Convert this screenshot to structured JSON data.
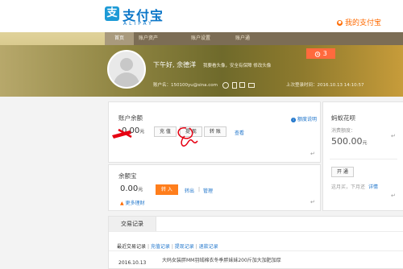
{
  "brand": {
    "cn": "支付宝",
    "en": "ALIPAY",
    "logo_char": "支"
  },
  "my_alipay": {
    "label": "我的支付宝",
    "icon": "alipay-dot-icon"
  },
  "nav": {
    "items": [
      "首页",
      "账户资产",
      "账户设置",
      "账户通"
    ]
  },
  "profile": {
    "greeting": "下午好, 余德洋",
    "tagline": "我要看头像，安全有保障 修改头像",
    "account_label": "账户名：",
    "account_value": "150100yu@sina.com",
    "login_label": "上次登录时间：",
    "login_time": "2016.10.13 14:10:57"
  },
  "notice": {
    "count": "3",
    "icon": "alarm-clock-icon"
  },
  "balance": {
    "title": "账户余额",
    "amount": "0.00",
    "unit": "元",
    "btn_recharge": "充 值",
    "btn_withdraw": "提 现",
    "btn_transfer": "转 账",
    "view": "查看",
    "settings": "额度说明"
  },
  "yuebao": {
    "title": "余额宝",
    "amount": "0.00",
    "unit": "元",
    "btn_in": "转 入",
    "link_out": "转出",
    "link_manage": "管理",
    "link_more": "更多理财"
  },
  "huabei": {
    "title": "蚂蚁花呗",
    "limit_label": "消费额度：",
    "amount": "500.00",
    "unit": "元",
    "btn_open": "开 通",
    "desc": "这月买，下月还",
    "detail": "详情"
  },
  "records": {
    "tab": "交易记录",
    "filter_active": "最近交易记录",
    "filters": [
      "充值记录",
      "提现记录",
      "退款记录"
    ],
    "row_date": "2016.10.13",
    "row_desc": "大码女装胖MM羽绒棉衣冬季胖妹妹200斤加大加肥加厚"
  },
  "colors": {
    "nav_bg": "#7c6d55",
    "accent": "#ff6a00",
    "link": "#2277cc",
    "annotation_red": "#e60012"
  }
}
